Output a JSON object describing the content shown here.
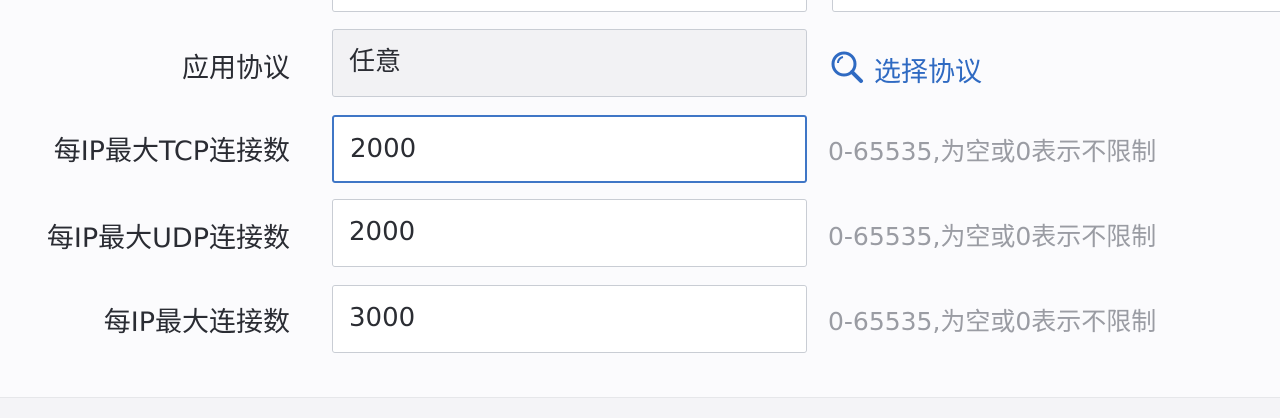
{
  "form": {
    "protocol": {
      "label": "应用协议",
      "value": "任意",
      "select_link": "选择协议"
    },
    "tcp_limit": {
      "label": "每IP最大TCP连接数",
      "value": "2000",
      "hint": "0-65535,为空或0表示不限制"
    },
    "udp_limit": {
      "label": "每IP最大UDP连接数",
      "value": "2000",
      "hint": "0-65535,为空或0表示不限制"
    },
    "total_limit": {
      "label": "每IP最大连接数",
      "value": "3000",
      "hint": "0-65535,为空或0表示不限制"
    }
  },
  "colors": {
    "link": "#2f6ac2",
    "focus_border": "#3f76c6",
    "hint_text": "#9a9ca3"
  },
  "icons": {
    "select_link_icon": "search-icon"
  }
}
